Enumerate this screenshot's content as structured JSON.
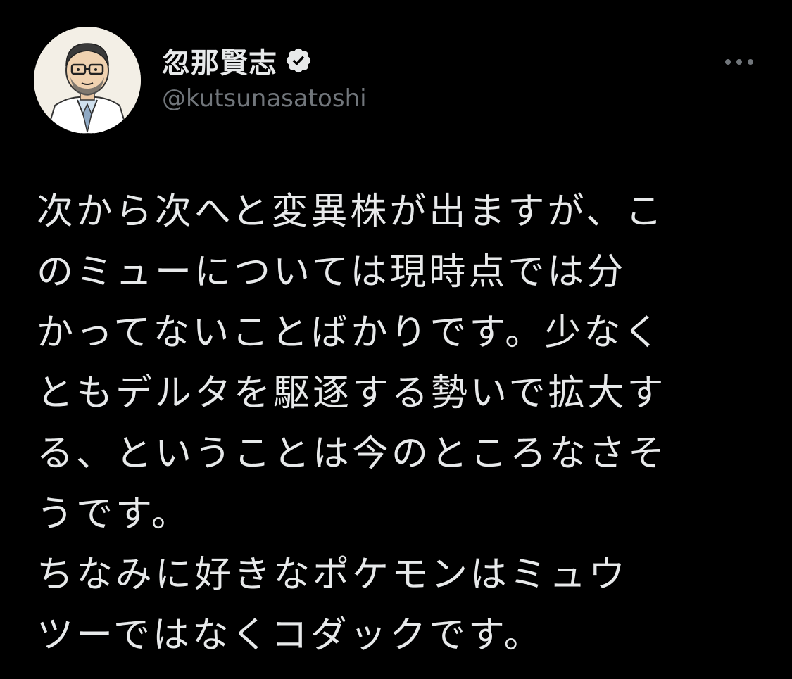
{
  "author": {
    "display_name": "忽那賢志",
    "handle": "@kutsunasatoshi",
    "verified": true,
    "avatar_icon": "avatar-illustration-doctor"
  },
  "actions": {
    "more_icon": "more-horizontal-icon"
  },
  "tweet": {
    "lines": [
      "次から次へと変異株が出ますが、こ",
      "のミューについては現時点では分",
      "かってないことばかりです。少なく",
      "ともデルタを駆逐する勢いで拡大す",
      "る、ということは今のところなさそ",
      "うです。",
      "ちなみに好きなポケモンはミュウ",
      "ツーではなくコダックです。"
    ]
  },
  "colors": {
    "background": "#000000",
    "text_primary": "#e7e9ea",
    "text_secondary": "#71767b",
    "verified_badge": "#e7e9ea"
  }
}
